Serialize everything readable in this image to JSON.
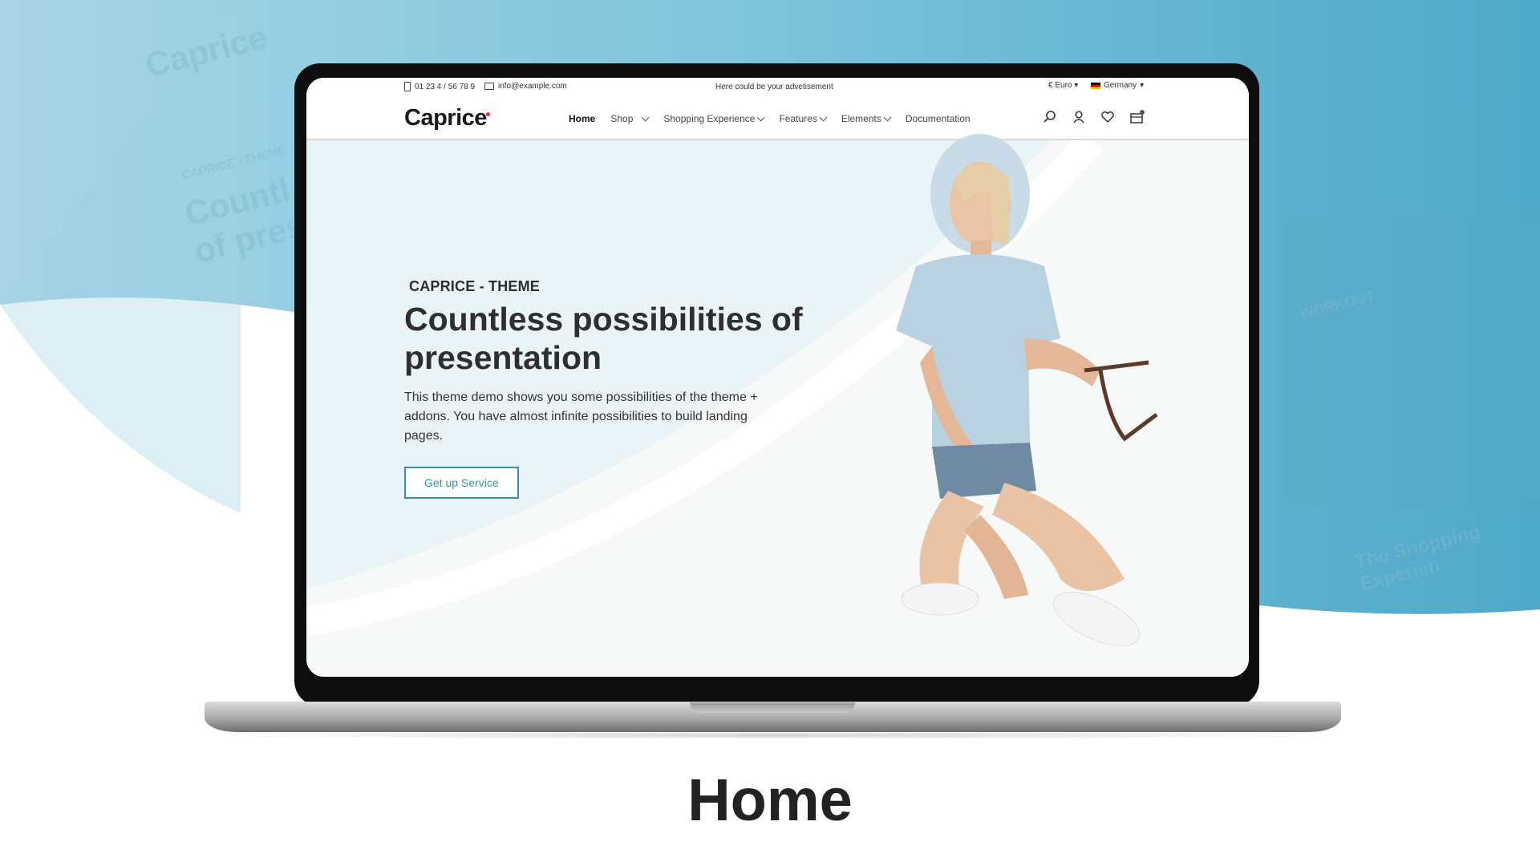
{
  "topbar": {
    "phone": "01 23 4 / 56 78 9",
    "email": "info@example.com",
    "advertisement": "Here could be your advetisement",
    "currency": "€ Euro",
    "country": "Germany"
  },
  "navbar": {
    "logo": "Caprice",
    "menu": [
      {
        "label": "Home"
      },
      {
        "label": "Shop"
      },
      {
        "label": "Shopping Experience"
      },
      {
        "label": "Features"
      },
      {
        "label": "Elements"
      },
      {
        "label": "Documentation"
      }
    ],
    "icons": [
      "search-icon",
      "user-icon",
      "heart-icon",
      "cart-icon"
    ],
    "cart_badge": "0"
  },
  "hero": {
    "eyebrow": "CAPRICE - THEME",
    "headline": "Countless possibilities of presentation",
    "description": "This theme demo shows you some possibilities of the theme + addons. You have almost infinite possibilities to build landing pages.",
    "cta": "Get up Service"
  },
  "background": {
    "ghost_logo": "Caprice",
    "ghost_heading": "Countl of pres",
    "ghost_tag": "CAPRICE - THEME",
    "ghost_workout": "WORKOUT",
    "ghost_shopping": "The Shopping Experien"
  },
  "caption": "Home",
  "colors": {
    "accent": "#3b8fac",
    "background_blue": "#69b7d3",
    "text_dark": "#2f2f2f"
  }
}
